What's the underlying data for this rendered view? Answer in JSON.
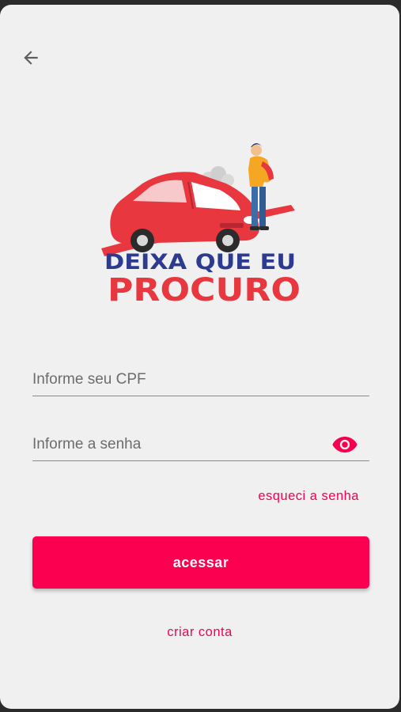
{
  "header": {
    "back_icon": "arrow-left-icon"
  },
  "logo": {
    "line1": "DEIXA QUE EU",
    "line2": "PROCURO"
  },
  "form": {
    "cpf_placeholder": "Informe seu CPF",
    "cpf_value": "",
    "password_placeholder": "Informe a senha",
    "password_value": "",
    "password_toggle_icon": "eye-icon",
    "forgot_label": "esqueci a senha",
    "submit_label": "acessar",
    "create_account_label": "criar conta"
  },
  "colors": {
    "accent": "#fb0050",
    "background": "#f1f0f1",
    "logo_red": "#e8373f",
    "logo_blue": "#2c3a8f"
  }
}
